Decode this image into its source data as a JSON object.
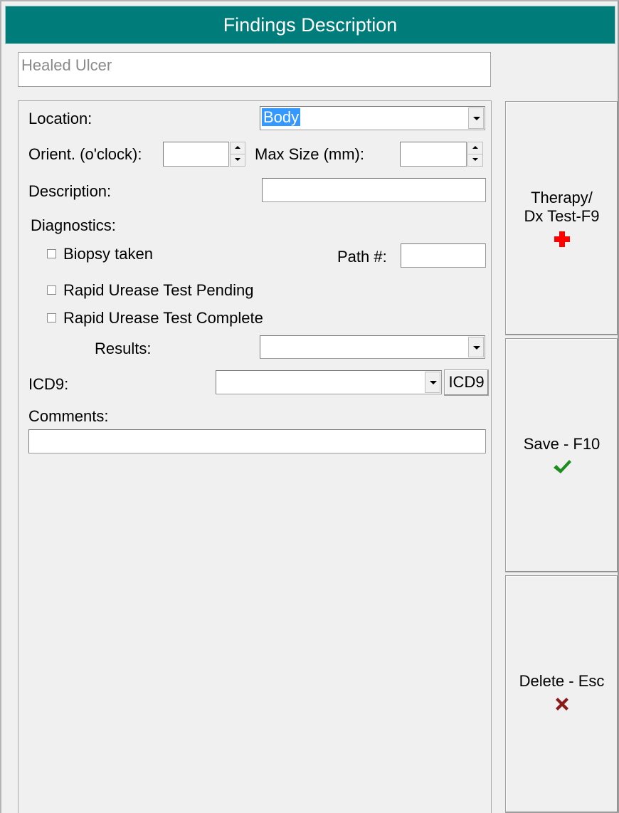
{
  "window": {
    "title": "Findings Description"
  },
  "finding": {
    "value": "Healed Ulcer"
  },
  "form": {
    "location_label": "Location:",
    "location_value": "Body",
    "orient_label": "Orient. (o'clock):",
    "orient_value": "",
    "maxsize_label": "Max Size (mm):",
    "maxsize_value": "",
    "description_label": "Description:",
    "description_value": "",
    "diagnostics_label": "Diagnostics:",
    "biopsy_label": "Biopsy taken",
    "biopsy_checked": false,
    "path_label": "Path #:",
    "path_value": "",
    "rut_pending_label": "Rapid Urease Test Pending",
    "rut_pending_checked": false,
    "rut_complete_label": "Rapid Urease Test Complete",
    "rut_complete_checked": false,
    "results_label": "Results:",
    "results_value": "",
    "icd9_label": "ICD9:",
    "icd9_value": "",
    "icd9_button": "ICD9",
    "comments_label": "Comments:",
    "comments_value": ""
  },
  "actions": {
    "therapy_line1": "Therapy/",
    "therapy_line2": "Dx Test-F9",
    "therapy_icon": "red-cross-icon",
    "save_label": "Save - F10",
    "save_icon": "green-check-icon",
    "delete_label": "Delete - Esc",
    "delete_icon": "dark-red-x-icon"
  },
  "colors": {
    "titlebar": "#007c7a",
    "selection": "#3399ff",
    "therapy_icon": "#ff0000",
    "save_icon": "#1e8c1e",
    "delete_icon": "#8b1a1a"
  }
}
